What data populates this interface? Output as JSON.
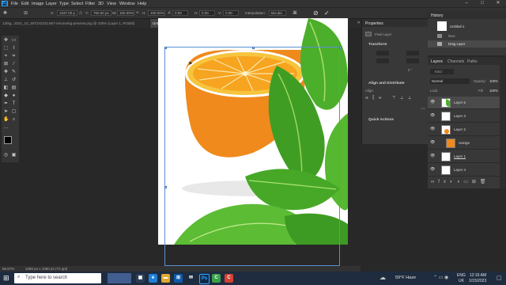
{
  "menubar": {
    "app_logo": "Ps",
    "items": [
      "File",
      "Edit",
      "Image",
      "Layer",
      "Type",
      "Select",
      "Filter",
      "3D",
      "View",
      "Window",
      "Help"
    ]
  },
  "options_bar": {
    "x_value": "1037.00 p",
    "y_value": "750.50 px",
    "w_value": "100.00%",
    "h_value": "100.00%",
    "angle": "0.00",
    "h_skew": "0.00",
    "v_skew": "0.00",
    "interpolation_label": "Interpolation:",
    "interpolation_value": "Bicubic"
  },
  "tabs": [
    {
      "label": "13rkg...2021_10_28T142242.667-removebg-preview.png @ 100% (Layer 1, RGB/8)",
      "active": false
    },
    {
      "label": "Untitled-1 @ 66.7% (Layer 5, RGB/8#) *",
      "active": true
    },
    {
      "label": "images (2).jpg @ 100% (Layer 0, RGB/8#) *",
      "active": false
    }
  ],
  "status": {
    "zoom": "66.67%",
    "doc_info": "1080 px x 1080 px (72 ppi)"
  },
  "properties": {
    "tab_label": "Properties",
    "layer_type": "Pixel Layer",
    "transform_title": "Transform",
    "align_title": "Align and Distribute",
    "align_label": "Align:",
    "quick_actions_title": "Quick Actions",
    "angle_value": "0 °"
  },
  "history": {
    "tab_label": "History",
    "snapshot": "Untitled-1",
    "items": [
      "New",
      "Drag Layer"
    ]
  },
  "layers_panel": {
    "tabs": [
      "Layers",
      "Channels",
      "Paths"
    ],
    "kind_label": "Kind",
    "blend_mode": "Normal",
    "opacity_label": "Opacity:",
    "opacity_value": "100%",
    "lock_label": "Lock:",
    "fill_label": "Fill:",
    "fill_value": "100%",
    "layers": [
      {
        "name": "Layer 5",
        "selected": true
      },
      {
        "name": "Layer 3",
        "selected": false
      },
      {
        "name": "Layer 2",
        "selected": false
      },
      {
        "name": "orange",
        "selected": false
      },
      {
        "name": "Layer 1",
        "selected": false
      },
      {
        "name": "Layer 4",
        "selected": false
      }
    ]
  },
  "taskbar": {
    "search_placeholder": "Type here to search",
    "weather": "59°F Haze",
    "language": "ENG",
    "region": "UK",
    "time": "12:16 AM",
    "date": "1/15/2023"
  },
  "colors": {
    "accent_blue": "#31a8ff",
    "foreground_swatch": "#000000",
    "background_swatch": "#e8791a",
    "orange_fruit": "#f08a1c",
    "mint_leaf": "#4caf2c"
  }
}
